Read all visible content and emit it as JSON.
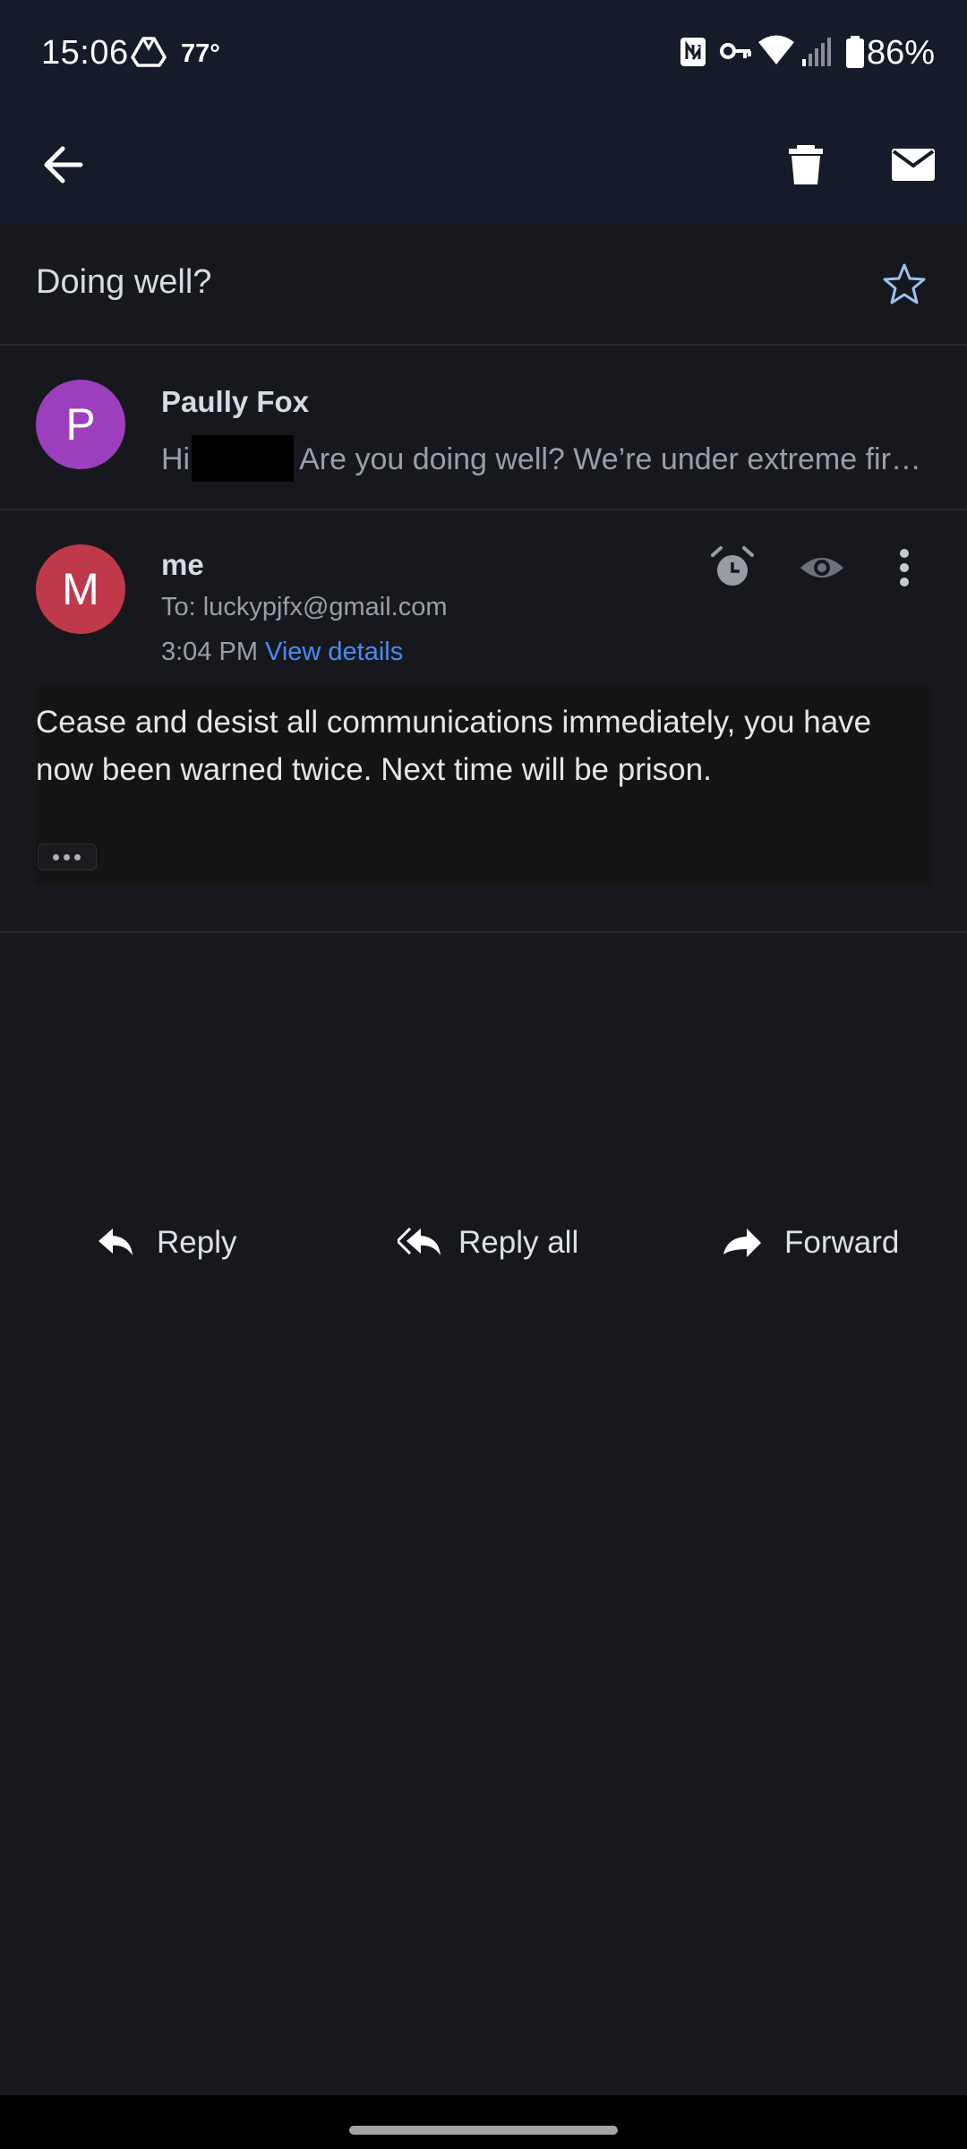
{
  "status_bar": {
    "time": "15:06",
    "temperature": "77°",
    "battery": "86%"
  },
  "app_bar": {
    "back_icon": "arrow-left-icon",
    "delete_icon": "trash-icon",
    "mark_unread_icon": "mail-icon"
  },
  "thread": {
    "subject": "Doing well?",
    "star_icon": "star-outline-icon"
  },
  "messages": [
    {
      "avatar_letter": "P",
      "avatar_color": "#9b3fbd",
      "sender": "Paully Fox",
      "snippet_before": "Hi",
      "snippet_after": "Are you doing well? We’re under extreme fir…"
    },
    {
      "avatar_letter": "M",
      "avatar_color": "#c0394b",
      "sender": "me",
      "to": "To: luckypjfx@gmail.com",
      "time": "3:04 PM",
      "view_details": "View details",
      "body": "Cease and desist all communications immediately, you have now been warned twice. Next time will be prison."
    }
  ],
  "actions": {
    "reply": "Reply",
    "reply_all": "Reply all",
    "forward": "Forward"
  },
  "colors": {
    "background": "#17181d",
    "header": "#161b29",
    "link": "#4a8cf0"
  }
}
